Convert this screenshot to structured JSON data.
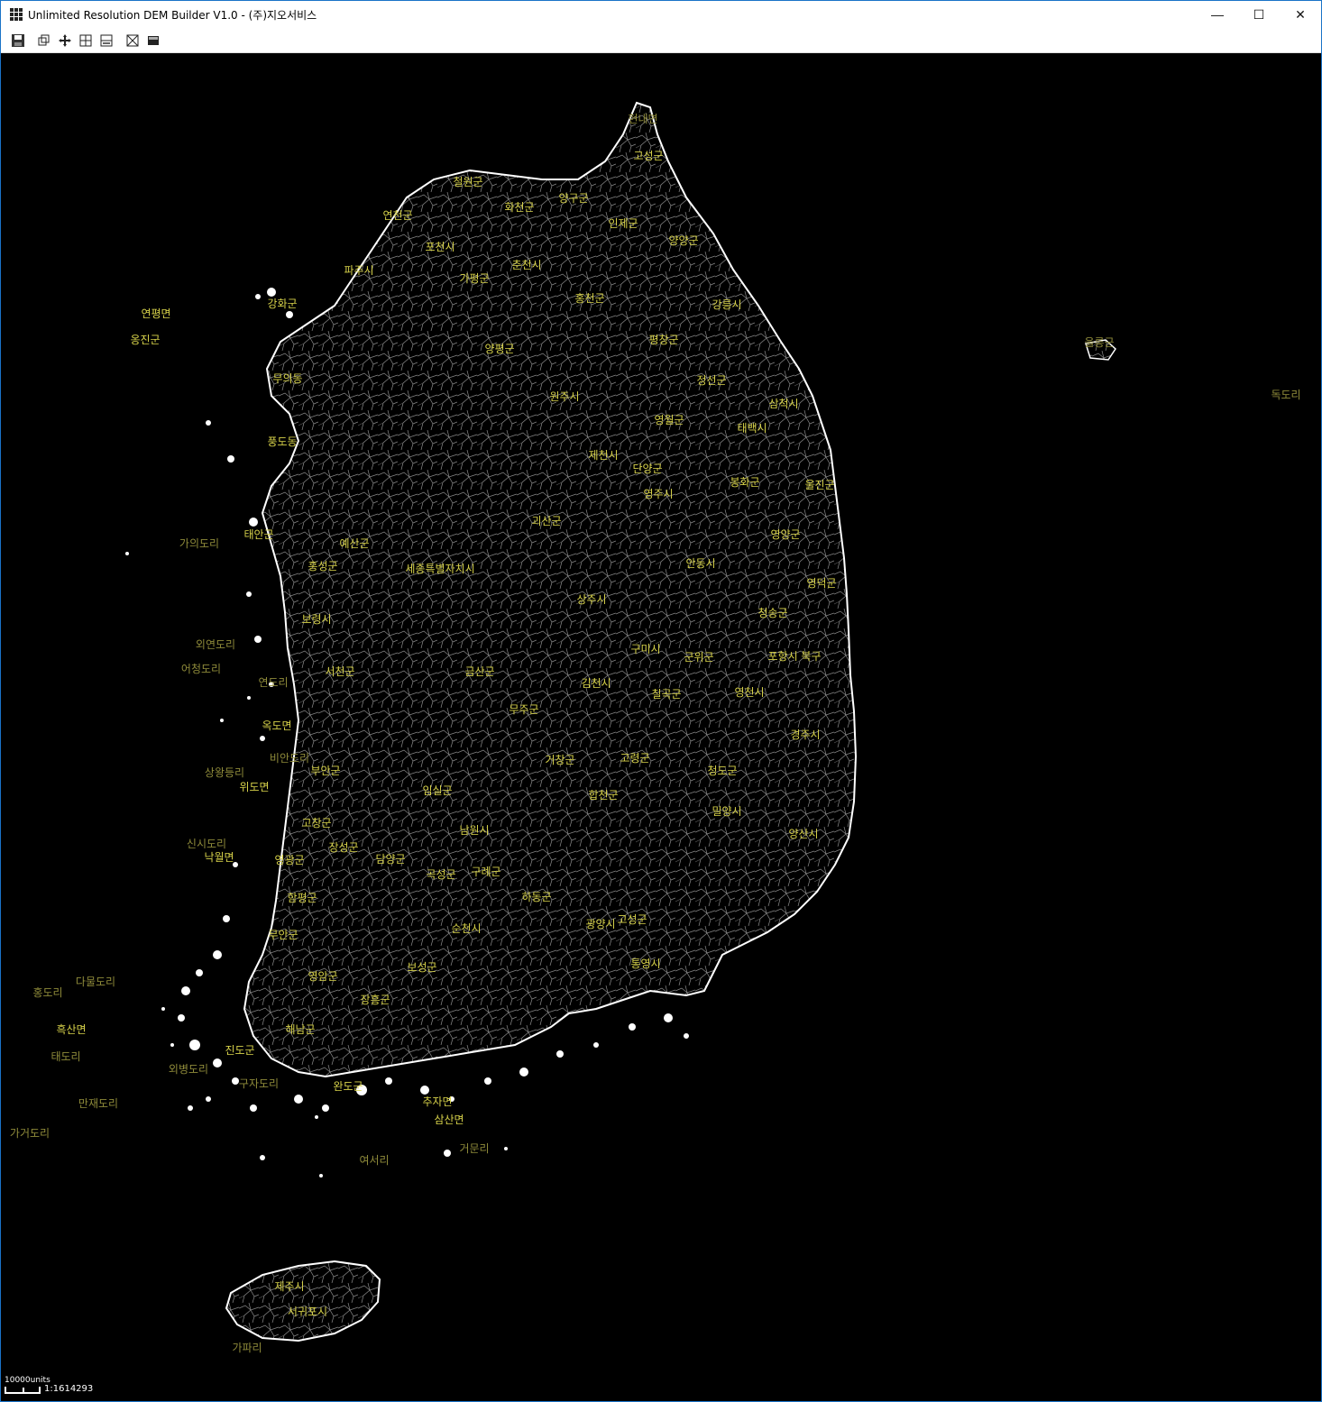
{
  "window": {
    "title": "Unlimited Resolution DEM Builder V1.0 - (주)지오서비스",
    "minimize": "—",
    "maximize": "☐",
    "close": "✕"
  },
  "toolbar": {
    "icons": [
      "save-icon",
      "layers-icon",
      "pan-icon",
      "grid-icon",
      "split-icon",
      "transform-icon",
      "raster-icon"
    ]
  },
  "status": {
    "scale_units": "10000units",
    "scale_value": "1:1614293"
  },
  "colors": {
    "background": "#000000",
    "boundary": "#ffffff",
    "label": "#d7d24a"
  },
  "labels": [
    {
      "text": "현내면",
      "bright": false
    },
    {
      "text": "고성군",
      "bright": true
    },
    {
      "text": "철원군",
      "bright": true
    },
    {
      "text": "화천군",
      "bright": true
    },
    {
      "text": "양구군",
      "bright": true
    },
    {
      "text": "인제군",
      "bright": true
    },
    {
      "text": "양양군",
      "bright": true
    },
    {
      "text": "연천군",
      "bright": true
    },
    {
      "text": "포천시",
      "bright": true
    },
    {
      "text": "춘천시",
      "bright": true
    },
    {
      "text": "파주시",
      "bright": true
    },
    {
      "text": "홍천군",
      "bright": true
    },
    {
      "text": "강릉시",
      "bright": true
    },
    {
      "text": "연평면",
      "bright": true
    },
    {
      "text": "옹진군",
      "bright": true
    },
    {
      "text": "강화군",
      "bright": true
    },
    {
      "text": "가평군",
      "bright": true
    },
    {
      "text": "양평군",
      "bright": true
    },
    {
      "text": "평창군",
      "bright": true
    },
    {
      "text": "울릉군",
      "bright": false
    },
    {
      "text": "독도리",
      "bright": false
    },
    {
      "text": "무의동",
      "bright": true
    },
    {
      "text": "원주시",
      "bright": true
    },
    {
      "text": "정선군",
      "bright": true
    },
    {
      "text": "삼척시",
      "bright": true
    },
    {
      "text": "태백시",
      "bright": true
    },
    {
      "text": "영월군",
      "bright": true
    },
    {
      "text": "제천시",
      "bright": true
    },
    {
      "text": "풍도동",
      "bright": true
    },
    {
      "text": "단양군",
      "bright": true
    },
    {
      "text": "봉화군",
      "bright": true
    },
    {
      "text": "울진군",
      "bright": true
    },
    {
      "text": "태안군",
      "bright": true
    },
    {
      "text": "가의도리",
      "bright": false
    },
    {
      "text": "예산군",
      "bright": true
    },
    {
      "text": "영주시",
      "bright": true
    },
    {
      "text": "괴산군",
      "bright": true
    },
    {
      "text": "영양군",
      "bright": true
    },
    {
      "text": "세종특별자치시",
      "bright": true
    },
    {
      "text": "홍성군",
      "bright": true
    },
    {
      "text": "안동시",
      "bright": true
    },
    {
      "text": "영덕군",
      "bright": true
    },
    {
      "text": "보령시",
      "bright": true
    },
    {
      "text": "상주시",
      "bright": true
    },
    {
      "text": "청송군",
      "bright": true
    },
    {
      "text": "외연도리",
      "bright": false
    },
    {
      "text": "어청도리",
      "bright": false
    },
    {
      "text": "연도리",
      "bright": false
    },
    {
      "text": "서천군",
      "bright": true
    },
    {
      "text": "금산군",
      "bright": true
    },
    {
      "text": "구미시",
      "bright": true
    },
    {
      "text": "군위군",
      "bright": true
    },
    {
      "text": "포항시 북구",
      "bright": true
    },
    {
      "text": "김천시",
      "bright": true
    },
    {
      "text": "칠곡군",
      "bright": true
    },
    {
      "text": "영천시",
      "bright": true
    },
    {
      "text": "옥도면",
      "bright": true
    },
    {
      "text": "무주군",
      "bright": true
    },
    {
      "text": "경주시",
      "bright": true
    },
    {
      "text": "비안도리",
      "bright": false
    },
    {
      "text": "부안군",
      "bright": true
    },
    {
      "text": "거창군",
      "bright": true
    },
    {
      "text": "고령군",
      "bright": true
    },
    {
      "text": "청도군",
      "bright": true
    },
    {
      "text": "상왕등리",
      "bright": false
    },
    {
      "text": "위도면",
      "bright": true
    },
    {
      "text": "임실군",
      "bright": true
    },
    {
      "text": "합천군",
      "bright": true
    },
    {
      "text": "밀양시",
      "bright": true
    },
    {
      "text": "고창군",
      "bright": true
    },
    {
      "text": "남원시",
      "bright": true
    },
    {
      "text": "양산시",
      "bright": true
    },
    {
      "text": "신시도리",
      "bright": false
    },
    {
      "text": "낙월면",
      "bright": true
    },
    {
      "text": "영광군",
      "bright": true
    },
    {
      "text": "장성군",
      "bright": true
    },
    {
      "text": "담양군",
      "bright": true
    },
    {
      "text": "곡성군",
      "bright": true
    },
    {
      "text": "구례군",
      "bright": true
    },
    {
      "text": "함평군",
      "bright": true
    },
    {
      "text": "하동군",
      "bright": true
    },
    {
      "text": "광양시",
      "bright": true
    },
    {
      "text": "고성군",
      "bright": true
    },
    {
      "text": "무안군",
      "bright": true
    },
    {
      "text": "순천시",
      "bright": true
    },
    {
      "text": "영암군",
      "bright": true
    },
    {
      "text": "보성군",
      "bright": true
    },
    {
      "text": "통영시",
      "bright": true
    },
    {
      "text": "다물도리",
      "bright": false
    },
    {
      "text": "홍도리",
      "bright": false
    },
    {
      "text": "장흥군",
      "bright": true
    },
    {
      "text": "흑산면",
      "bright": true
    },
    {
      "text": "해남군",
      "bright": true
    },
    {
      "text": "태도리",
      "bright": false
    },
    {
      "text": "진도군",
      "bright": true
    },
    {
      "text": "외병도리",
      "bright": false
    },
    {
      "text": "구자도리",
      "bright": false
    },
    {
      "text": "완도군",
      "bright": true
    },
    {
      "text": "만재도리",
      "bright": false
    },
    {
      "text": "가거도리",
      "bright": false
    },
    {
      "text": "삼산면",
      "bright": true
    },
    {
      "text": "거문리",
      "bright": false
    },
    {
      "text": "추자면",
      "bright": true
    },
    {
      "text": "여서리",
      "bright": false
    },
    {
      "text": "제주시",
      "bright": true
    },
    {
      "text": "서귀포시",
      "bright": true
    },
    {
      "text": "가파리",
      "bright": false
    }
  ]
}
